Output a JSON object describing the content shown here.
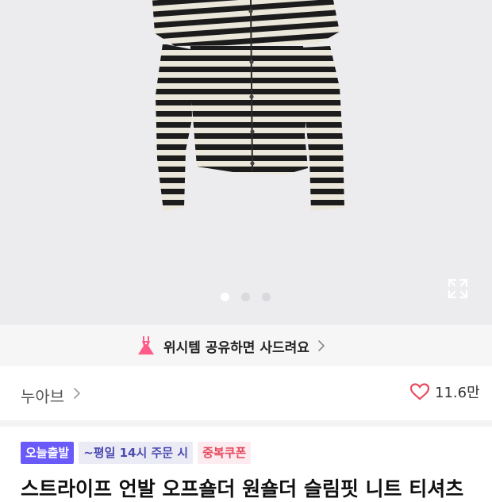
{
  "banner": {
    "text": "위시템 공유하면 사드려요",
    "icon": "dress-icon"
  },
  "carousel": {
    "total_images": 3,
    "active_index": 0,
    "icon": "expand-icon"
  },
  "brand": {
    "name": "누아브",
    "likes": "11.6만",
    "icon": "heart-icon"
  },
  "tags": {
    "today": "오늘출발",
    "time": "~평일 14시 주문 시",
    "coupon": "중복쿠폰"
  },
  "product": {
    "title": "스트라이프 언발 오프숄더 원숄더 슬림핏 니트 티셔츠"
  },
  "colors": {
    "accent": "#6a5af9",
    "heart": "#e94a5f",
    "coupon": "#e6485e",
    "hero_bg": "#ececef"
  }
}
